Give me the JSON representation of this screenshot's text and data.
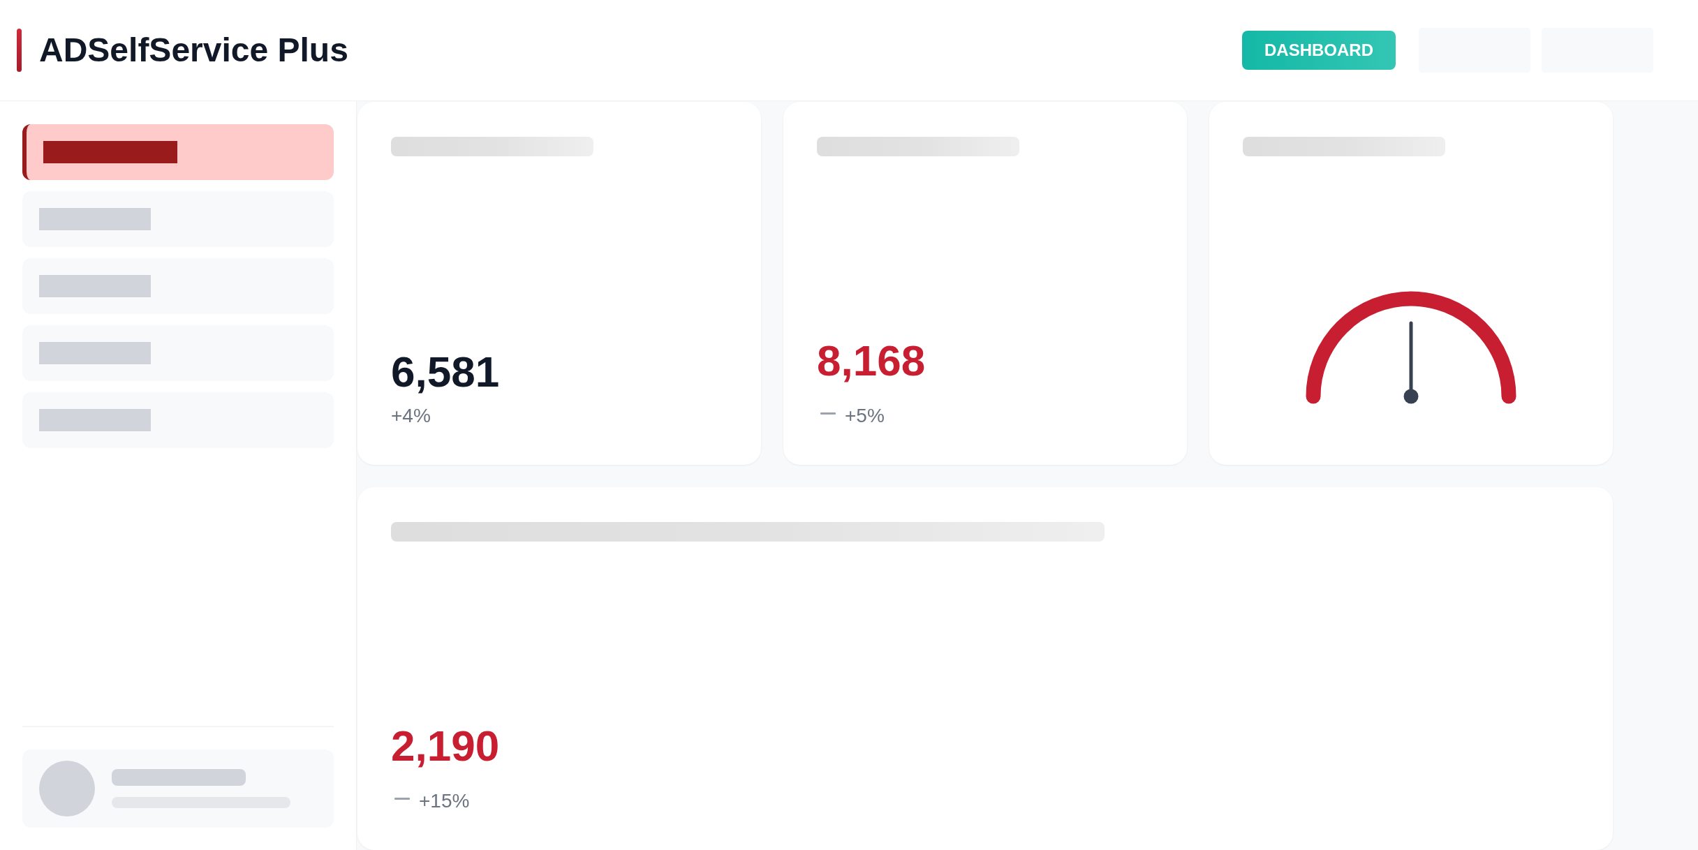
{
  "header": {
    "title": "ADSelfService Plus",
    "buttons": [
      {
        "kind": "primary",
        "label": "DASHBOARD"
      },
      {
        "kind": "blank"
      },
      {
        "kind": "blank"
      }
    ]
  },
  "sidebar": {
    "items": [
      {
        "selected": true
      },
      {
        "selected": false
      },
      {
        "selected": false
      },
      {
        "selected": false
      },
      {
        "selected": false
      }
    ]
  },
  "cards": [
    {
      "kind": "stat",
      "value": "6,581",
      "color": "#111827",
      "change": "+4%",
      "trend_icon": false
    },
    {
      "kind": "stat",
      "value": "8,168",
      "color": "#c81e32",
      "change": "+5%",
      "trend_icon": true
    },
    {
      "kind": "gauge",
      "level": 0.5
    }
  ],
  "wide_card": {
    "value": "2,190",
    "color": "#c81e32",
    "change": "+15%",
    "trend_icon": true
  }
}
